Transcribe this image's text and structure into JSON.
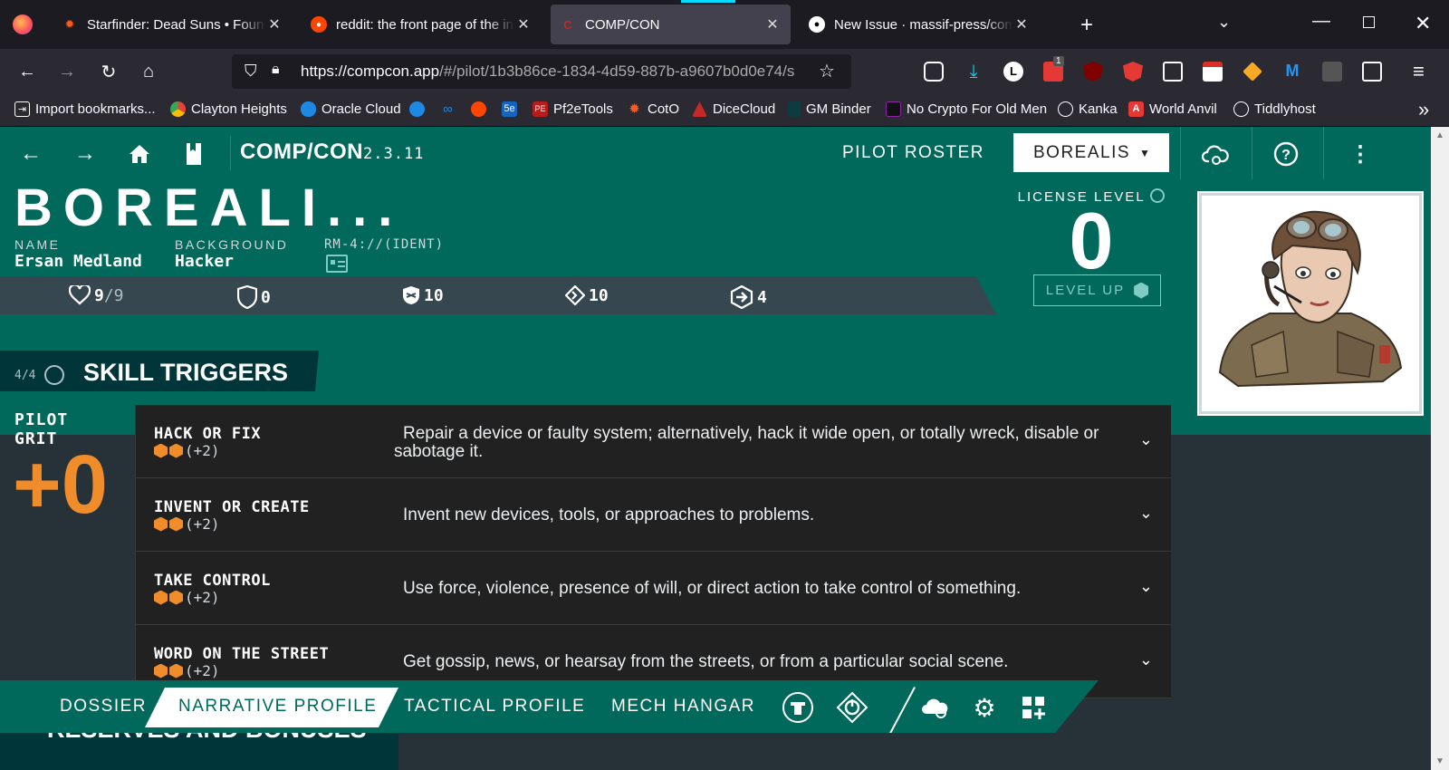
{
  "browser": {
    "tabs": [
      {
        "title": "Starfinder: Dead Suns • Foundry VTT",
        "icon": "d20-icon",
        "active": false
      },
      {
        "title": "reddit: the front page of the internet",
        "icon": "reddit-icon",
        "active": false
      },
      {
        "title": "COMP/CON",
        "icon": "compcon-icon",
        "active": true
      },
      {
        "title": "New Issue · massif-press/compcon",
        "icon": "github-icon",
        "active": false
      }
    ],
    "url_host": "https://compcon.app",
    "url_path": "/#/pilot/1b3b86ce-1834-4d59-887b-a9607b0d0e74/s",
    "extension_badge": "1",
    "bookmarks": [
      "Import bookmarks...",
      "Clayton Heights",
      "Oracle Cloud",
      "",
      "",
      "",
      "",
      "Pf2eTools",
      "CotO",
      "DiceCloud",
      "GM Binder",
      "No Crypto For Old Men",
      "Kanka",
      "World Anvil",
      "Tiddlyhost"
    ]
  },
  "app": {
    "brand": "COMP/CON",
    "version": "2.3.11",
    "roster_label": "PILOT ROSTER",
    "selected_pilot": "BOREALIS",
    "callsign": "BOREALI...",
    "name_label": "NAME",
    "name_value": "Ersan Medland",
    "background_label": "BACKGROUND",
    "background_value": "Hacker",
    "ident_label": "RM-4://(IDENT)",
    "stats": {
      "hp": "9",
      "hp_max": "/9",
      "armor": "0",
      "evasion": "10",
      "edef": "10",
      "speed": "4"
    },
    "license_label": "LICENSE LEVEL",
    "license_level": "0",
    "level_up_label": "LEVEL UP",
    "skill_section": {
      "count": "4/4",
      "title": "SKILL TRIGGERS",
      "grit_label": "PILOT GRIT",
      "grit_value": "+0",
      "skills": [
        {
          "name": "HACK OR FIX",
          "bonus": "(+2)",
          "desc": "Repair a device or faulty system; alternatively, hack it wide open, or totally wreck, disable or sabotage it."
        },
        {
          "name": "INVENT OR CREATE",
          "bonus": "(+2)",
          "desc": "Invent new devices, tools, or approaches to problems."
        },
        {
          "name": "TAKE CONTROL",
          "bonus": "(+2)",
          "desc": "Use force, violence, presence of will, or direct action to take control of something."
        },
        {
          "name": "WORD ON THE STREET",
          "bonus": "(+2)",
          "desc": "Get gossip, news, or hearsay from the streets, or from a particular social scene."
        }
      ]
    },
    "reserves_title": "RESERVES AND BONUSES",
    "bottom_nav": {
      "dossier": "DOSSIER",
      "narrative": "NARRATIVE PROFILE",
      "tactical": "TACTICAL PROFILE",
      "hangar": "MECH HANGAR"
    },
    "colors": {
      "teal": "#00695c",
      "dark_teal": "#00363a",
      "accent_orange": "#f08c2a",
      "panel": "#212121"
    }
  }
}
